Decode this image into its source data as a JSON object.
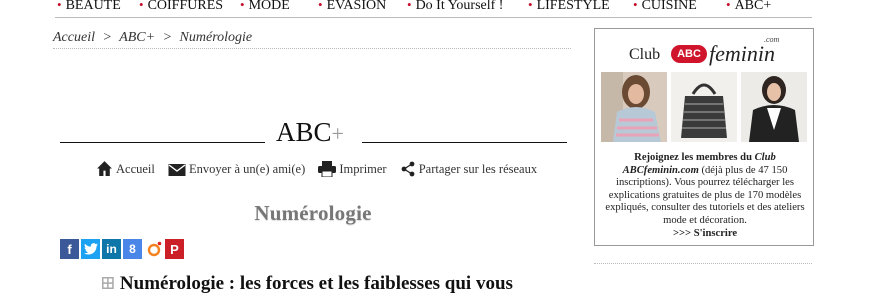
{
  "nav": {
    "items": [
      "BEAUTE",
      "COIFFURES",
      "MODE",
      "EVASION",
      "Do It Yourself !",
      "LIFESTYLE",
      "CUISINE",
      "ABC+"
    ]
  },
  "breadcrumb": {
    "home": "Accueil",
    "sep1": ">",
    "section": "ABC+",
    "sep2": ">",
    "current": "Numérologie"
  },
  "section": {
    "title": "ABC",
    "plus": "+"
  },
  "actions": {
    "home": "Accueil",
    "email": "Envoyer à un(e) ami(e)",
    "print": "Imprimer",
    "share": "Partager sur les réseaux"
  },
  "page_title": "Numérologie",
  "social": {
    "facebook": "f",
    "google": "8",
    "linkedin": "in",
    "pinterest": "P"
  },
  "article": {
    "title": "Numérologie : les forces et les faiblesses qui vous"
  },
  "ad": {
    "club": "Club",
    "abc": "ABC",
    "feminin": "feminin",
    "com": ".com",
    "text_lead": "Rejoignez les membres du ",
    "text_club": "Club ABCfeminin.com",
    "text_count": " (déjà plus de 47 150 inscriptions). Vous pourrez télécharger les explications gratuites de plus de 170 modèles expliqués, consulter des tutoriels et des ateliers mode et décoration.",
    "cta": ">>> S'inscrire"
  },
  "colors": {
    "accent_red": "#c8102e",
    "facebook": "#3b5998",
    "twitter": "#1da1f2",
    "linkedin": "#0e76a8",
    "google": "#4a86e8",
    "pinterest": "#cb2027"
  }
}
